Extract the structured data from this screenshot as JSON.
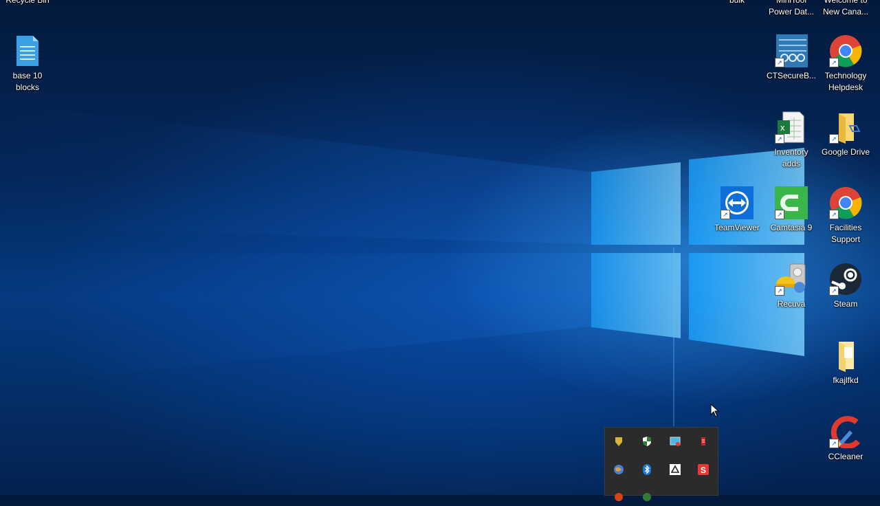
{
  "desktop": {
    "icons": [
      {
        "id": "recycle",
        "label": "Recycle Bin"
      },
      {
        "id": "base10",
        "label": "base 10\nblocks"
      },
      {
        "id": "bulk",
        "label": "bulk"
      },
      {
        "id": "minitool",
        "label": "MiniTool\nPower Dat..."
      },
      {
        "id": "welcome",
        "label": "Welcome to\nNew Cana..."
      },
      {
        "id": "ctsecure",
        "label": "CTSecureB..."
      },
      {
        "id": "techhelp",
        "label": "Technology\nHelpdesk"
      },
      {
        "id": "inventory",
        "label": "Inventory\nadds"
      },
      {
        "id": "gdrive",
        "label": "Google Drive"
      },
      {
        "id": "teamviewer",
        "label": "TeamViewer"
      },
      {
        "id": "camtasia",
        "label": "Camtasia 9"
      },
      {
        "id": "facilities",
        "label": "Facilities\nSupport"
      },
      {
        "id": "recuva",
        "label": "Recuva"
      },
      {
        "id": "steam",
        "label": "Steam"
      },
      {
        "id": "fkajlfkd",
        "label": "fkajlfkd"
      },
      {
        "id": "ccleaner",
        "label": "CCleaner"
      }
    ]
  },
  "tray_overflow": {
    "icons": [
      "shield-yellow-icon",
      "defender-shield-icon",
      "network-monitor-icon",
      "red-battery-icon",
      "globe-icon",
      "bluetooth-icon",
      "google-drive-tray-icon",
      "snagit-icon"
    ]
  },
  "colors": {
    "accent": "#2b9cff",
    "tray_bg": "#2b2b2b"
  }
}
